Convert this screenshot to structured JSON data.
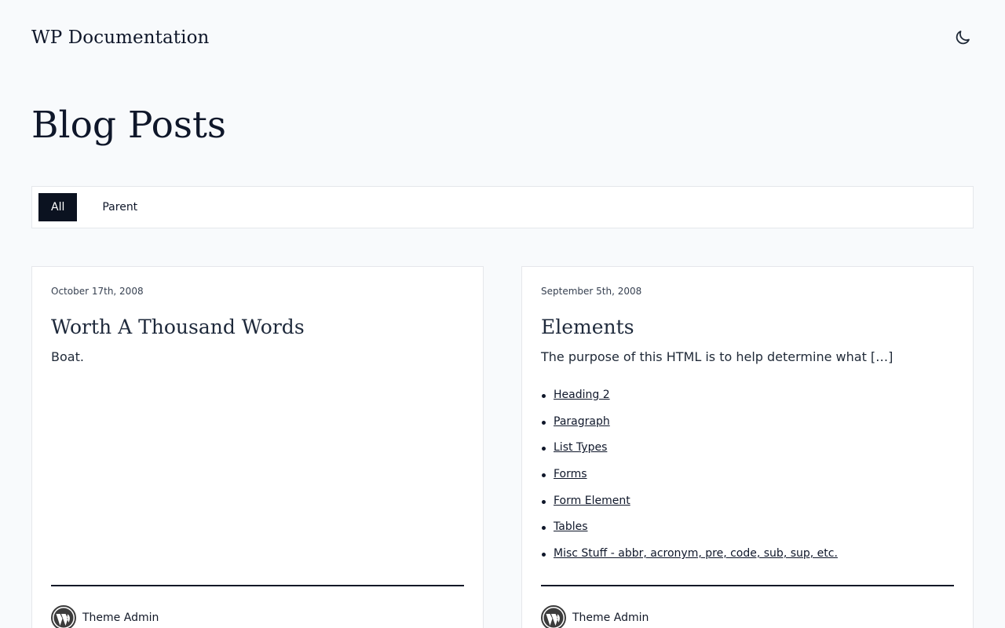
{
  "header": {
    "site_title": "WP Documentation",
    "theme_toggle_icon": "moon-icon"
  },
  "page": {
    "title": "Blog Posts"
  },
  "filters": [
    {
      "label": "All",
      "active": true
    },
    {
      "label": "Parent",
      "active": false
    }
  ],
  "posts": [
    {
      "date": "October 17th, 2008",
      "title": "Worth A Thousand Words",
      "excerpt": "Boat.",
      "links": [],
      "author": "Theme Admin",
      "avatar_icon": "wordpress-icon"
    },
    {
      "date": "September 5th, 2008",
      "title": "Elements",
      "excerpt": "The purpose of this HTML is to help determine what […]",
      "links": [
        "Heading 2",
        "Paragraph",
        "List Types",
        "Forms",
        "Form Element",
        "Tables",
        "Misc Stuff - abbr, acronym, pre, code, sub, sup, etc."
      ],
      "author": "Theme Admin",
      "avatar_icon": "wordpress-icon"
    }
  ],
  "colors": {
    "background": "#f8fafc",
    "active_filter_bg": "#0b1220",
    "card_border": "#e5e7eb"
  }
}
